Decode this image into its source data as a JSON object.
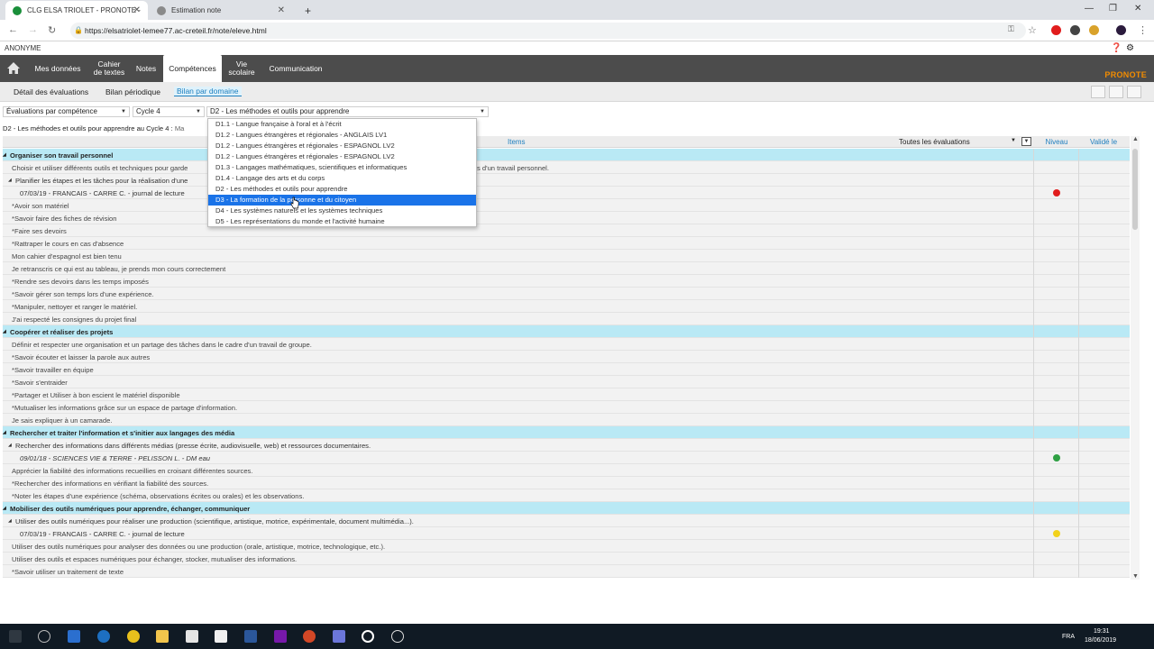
{
  "browser": {
    "tabs": [
      {
        "title": "CLG ELSA TRIOLET - PRONOTE -",
        "active": true
      },
      {
        "title": "Estimation note",
        "active": false
      }
    ],
    "url": "https://elsatriolet-lemee77.ac-creteil.fr/note/eleve.html"
  },
  "user": {
    "name": "ANONYME"
  },
  "menu": {
    "items": [
      "Mes données",
      "Cahier de textes",
      "Notes",
      "Compétences",
      "Vie scolaire",
      "Communication"
    ],
    "active": "Compétences",
    "cahier_line1": "Cahier",
    "cahier_line2": "de textes",
    "vie_line1": "Vie",
    "vie_line2": "scolaire",
    "logo": "PRONOTE"
  },
  "subtabs": {
    "detail": "Détail des évaluations",
    "bilan_periodique": "Bilan périodique",
    "bilan_domaine": "Bilan par domaine"
  },
  "filters": {
    "type": "Évaluations par compétence",
    "cycle": "Cycle 4",
    "domaine": "D2 - Les méthodes et outils pour apprendre"
  },
  "path": {
    "bold": "D2 - Les méthodes et outils pour apprendre au Cycle 4 :",
    "muted": "Ma"
  },
  "table": {
    "col_items": "Items",
    "col_filter": "Toutes les évaluations",
    "col_niveau": "Niveau",
    "col_valide": "Validé le"
  },
  "rows": [
    {
      "type": "domain",
      "text": "Organiser son travail personnel"
    },
    {
      "type": "item",
      "text": "Choisir et utiliser différents outils et techniques pour garde",
      "tail": "s d'un travail personnel."
    },
    {
      "type": "sub",
      "text": "Planifier les étapes et les tâches pour la réalisation d'une"
    },
    {
      "type": "eval",
      "text": "07/03/19 - FRANCAIS - CARRE C. - journal de lecture",
      "level_color": "#e11d1d"
    },
    {
      "type": "item",
      "text": "*Avoir son matériel"
    },
    {
      "type": "item",
      "text": "*Savoir faire des fiches de révision"
    },
    {
      "type": "item",
      "text": "*Faire ses devoirs"
    },
    {
      "type": "item",
      "text": "*Rattraper le cours en cas d'absence"
    },
    {
      "type": "item",
      "text": "Mon cahier d'espagnol est bien tenu"
    },
    {
      "type": "item",
      "text": "Je retranscris ce qui est au tableau, je prends mon cours correctement"
    },
    {
      "type": "item",
      "text": "*Rendre ses devoirs dans les temps imposés"
    },
    {
      "type": "item",
      "text": "*Savoir gérer son temps lors d'une expérience."
    },
    {
      "type": "item",
      "text": "*Manipuler, nettoyer et ranger le matériel."
    },
    {
      "type": "item",
      "text": "J'ai respecté les consignes du projet final"
    },
    {
      "type": "domain",
      "text": "Coopérer et réaliser des projets"
    },
    {
      "type": "item",
      "text": "Définir et respecter une organisation et un partage des tâches dans le cadre d'un travail de groupe."
    },
    {
      "type": "item",
      "text": "*Savoir écouter et laisser la parole aux autres"
    },
    {
      "type": "item",
      "text": "*Savoir travailler en équipe"
    },
    {
      "type": "item",
      "text": "*Savoir s'entraider"
    },
    {
      "type": "item",
      "text": "*Partager et Utiliser à bon escient le matériel disponible"
    },
    {
      "type": "item",
      "text": "*Mutualiser les informations grâce sur un espace de partage d'information."
    },
    {
      "type": "item",
      "text": "Je sais expliquer à un camarade."
    },
    {
      "type": "domain",
      "text": "Rechercher et traiter l'information et s'initier aux langages des média"
    },
    {
      "type": "sub",
      "text": "Rechercher des informations dans différents médias (presse écrite, audiovisuelle, web) et ressources documentaires."
    },
    {
      "type": "eval",
      "italic": true,
      "text": "09/01/18 - SCIENCES VIE & TERRE - PELISSON L. - DM eau",
      "level_color": "#2ea043"
    },
    {
      "type": "item",
      "text": "Apprécier la fiabilité des informations recueillies en croisant différentes sources."
    },
    {
      "type": "item",
      "text": "*Rechercher des informations en vérifiant la fiabilité des sources."
    },
    {
      "type": "item",
      "text": "*Noter les étapes d'une expérience (schéma, observations écrites ou orales) et les observations."
    },
    {
      "type": "domain",
      "text": "Mobiliser des outils numériques pour apprendre, échanger, communiquer"
    },
    {
      "type": "sub",
      "text": "Utiliser des outils numériques pour réaliser une production (scientifique, artistique, motrice, expérimentale, document multimédia...)."
    },
    {
      "type": "eval",
      "text": "07/03/19 - FRANCAIS - CARRE C. - journal de lecture",
      "level_color": "#f2d21b"
    },
    {
      "type": "item",
      "text": "Utiliser des outils numériques pour analyser des données ou une production (orale, artistique, motrice, technologique, etc.)."
    },
    {
      "type": "item",
      "text": "Utiliser des outils et espaces numériques pour échanger, stocker, mutualiser des informations."
    },
    {
      "type": "item",
      "text": "*Savoir utiliser un traitement de texte"
    }
  ],
  "dropdown": {
    "options": [
      "D1.1 - Langue française à l'oral et à l'écrit",
      "D1.2 - Langues étrangères et régionales - ANGLAIS LV1",
      "D1.2 - Langues étrangères et régionales - ESPAGNOL LV2",
      "D1.2 - Langues étrangères et régionales - ESPAGNOL LV2",
      "D1.3 - Langages mathématiques, scientifiques et informatiques",
      "D1.4 - Langage des arts et du corps",
      "D2 - Les méthodes et outils pour apprendre",
      "D3 - La formation de la personne et du citoyen",
      "D4 - Les systèmes naturels et les systèmes techniques",
      "D5 - Les représentations du monde et l'activité humaine"
    ],
    "highlighted_index": 7
  },
  "taskbar": {
    "lang": "FRA",
    "time": "19:31",
    "date": "18/06/2019"
  },
  "colors": {
    "menubar": "#4c4c4c",
    "domain_row": "#b9e9f5",
    "accent": "#1e7fbf",
    "highlight": "#1a73e8"
  }
}
